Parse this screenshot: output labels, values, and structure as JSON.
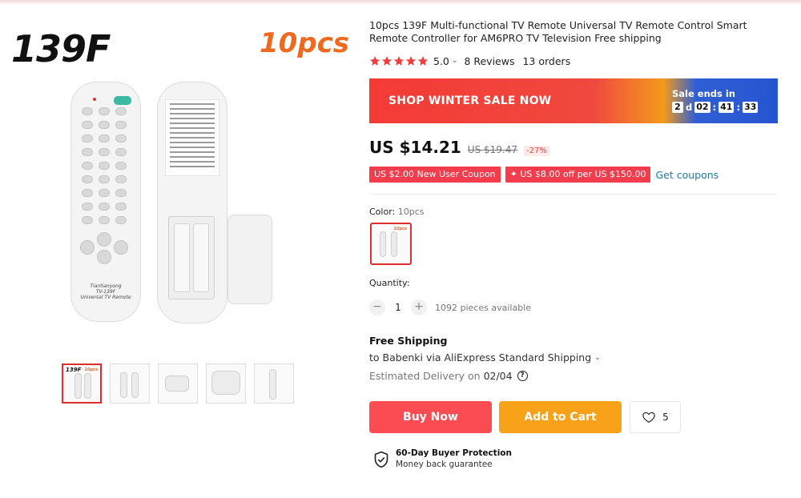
{
  "gallery": {
    "badge_model": "139F",
    "badge_qty": "10pcs",
    "remote_brand": "Tiantianyong",
    "remote_model": "TV-139F",
    "remote_caption": "Universal TV Remote",
    "thumb_badge_model": "139F",
    "thumb_badge_qty": "10pcs"
  },
  "product": {
    "title": "10pcs 139F Multi-functional TV Remote Universal TV Remote Control Smart Remote Controller for AM6PRO TV Television Free shipping",
    "rating": "5.0",
    "reviews": "8 Reviews",
    "orders": "13 orders",
    "star_color": "#f23d3d"
  },
  "sale": {
    "label": "SHOP WINTER SALE NOW",
    "ends_label": "Sale ends in",
    "days": "2",
    "days_unit": "d",
    "hours": "02",
    "minutes": "41",
    "seconds": "33"
  },
  "price": {
    "current": "US $14.21",
    "original": "US $19.47",
    "discount": "-27%"
  },
  "coupons": {
    "new_user": "US $2.00 New User Coupon",
    "store": "✦ US $8.00 off per US $150.00",
    "get_label": "Get coupons"
  },
  "variant": {
    "label": "Color:",
    "value": "10pcs",
    "swatch_badge": "10pcs"
  },
  "quantity": {
    "label": "Quantity:",
    "minus": "−",
    "value": "1",
    "plus": "+",
    "available": "1092 pieces available"
  },
  "shipping": {
    "title": "Free Shipping",
    "to_text": "to Babenki via AliExpress Standard Shipping",
    "delivery_label": "Estimated Delivery on",
    "delivery_date": "02/04",
    "help_glyph": "?"
  },
  "actions": {
    "buy_now": "Buy Now",
    "add_to_cart": "Add to Cart",
    "wishlist_count": "5"
  },
  "protection": {
    "title": "60-Day Buyer Protection",
    "subtitle": "Money back guarantee"
  },
  "colors": {
    "accent_red": "#f23d3d",
    "buy_now": "#fb4b53",
    "add_to_cart": "#f8a21a",
    "link": "#1f7aa6"
  }
}
